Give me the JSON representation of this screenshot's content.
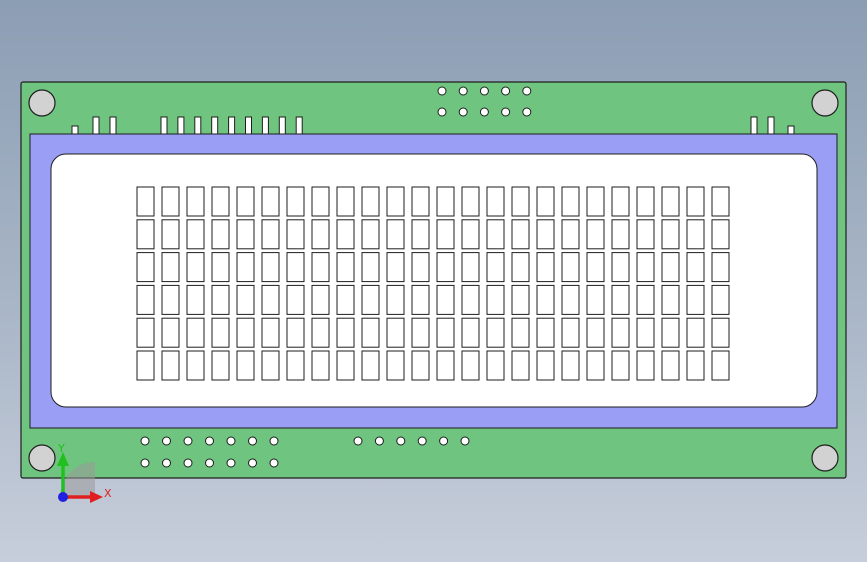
{
  "model": {
    "kind": "lcd-module-front-view",
    "display": {
      "rows": 6,
      "columns": 24
    },
    "colors": {
      "pcb": "#6fc47f",
      "bezel": "#9b9ef5",
      "screen": "#ffffff",
      "outline": "#1e1e1e",
      "background_top": "#8c9eb4",
      "background_bottom": "#c7cedb"
    },
    "mounting_holes": 4,
    "top_pin_header_rows": 2,
    "top_pins_per_row": 5,
    "bottom_left_pins_per_row": 7,
    "bottom_left_pin_rows": 2,
    "bottom_right_pins": 6,
    "left_tabs": 3,
    "middle_tabs": 9,
    "right_tabs": 3
  },
  "triad": {
    "x_label": "X",
    "y_label": "Y",
    "x_color": "#e02020",
    "y_color": "#20c020",
    "origin_color": "#2020e0"
  }
}
